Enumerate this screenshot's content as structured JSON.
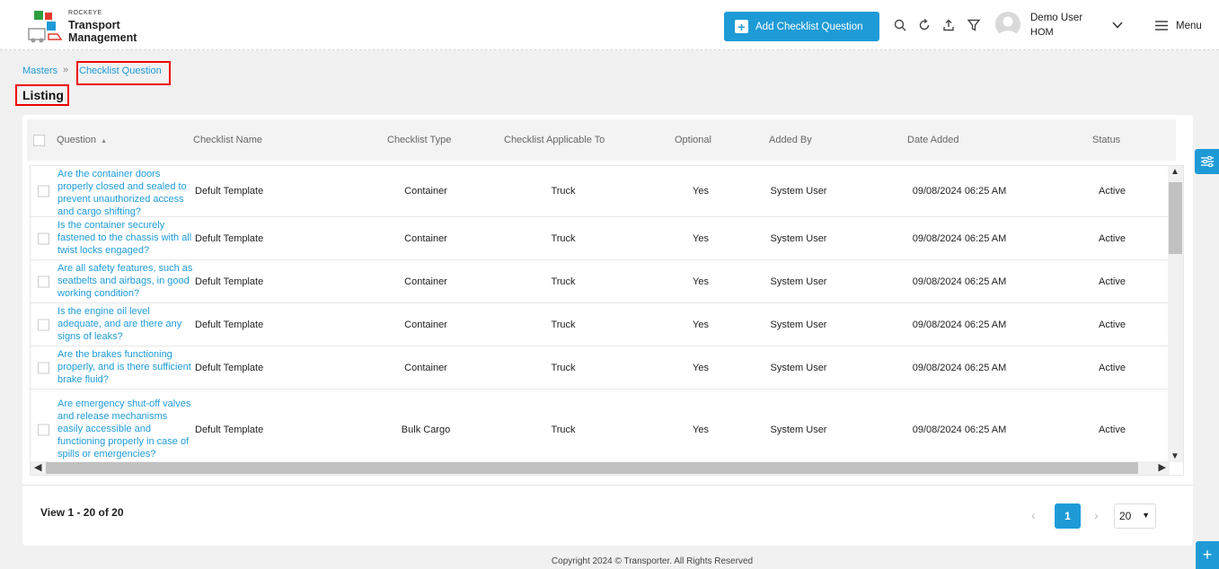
{
  "brand": {
    "small": "ROCKEYE",
    "line1": "Transport",
    "line2": "Management"
  },
  "header": {
    "add_button_label": "Add Checklist Question",
    "icons": [
      "search-icon",
      "refresh-icon",
      "upload-icon",
      "filter-icon"
    ],
    "user_name": "Demo User",
    "user_role": "HOM",
    "menu_label": "Menu"
  },
  "breadcrumb": {
    "parent": "Masters",
    "separator": "»",
    "current": "Checklist Question"
  },
  "page_title": "Listing",
  "table": {
    "columns": {
      "question": "Question",
      "checklist_name": "Checklist Name",
      "checklist_type": "Checklist Type",
      "applicable_to": "Checklist Applicable To",
      "optional": "Optional",
      "added_by": "Added By",
      "date_added": "Date Added",
      "status": "Status"
    },
    "sort_indicator": "▲",
    "rows": [
      {
        "question": "Are the container doors properly closed and sealed to prevent unauthorized access and cargo shifting?",
        "checklist_name": "Defult Template",
        "checklist_type": "Container",
        "applicable_to": "Truck",
        "optional": "Yes",
        "added_by": "System User",
        "date_added": "09/08/2024 06:25 AM",
        "status": "Active"
      },
      {
        "question": "Is the container securely fastened to the chassis with all twist locks engaged?",
        "checklist_name": "Defult Template",
        "checklist_type": "Container",
        "applicable_to": "Truck",
        "optional": "Yes",
        "added_by": "System User",
        "date_added": "09/08/2024 06:25 AM",
        "status": "Active"
      },
      {
        "question": "Are all safety features, such as seatbelts and airbags, in good working condition?",
        "checklist_name": "Defult Template",
        "checklist_type": "Container",
        "applicable_to": "Truck",
        "optional": "Yes",
        "added_by": "System User",
        "date_added": "09/08/2024 06:25 AM",
        "status": "Active"
      },
      {
        "question": "Is the engine oil level adequate, and are there any signs of leaks?",
        "checklist_name": "Defult Template",
        "checklist_type": "Container",
        "applicable_to": "Truck",
        "optional": "Yes",
        "added_by": "System User",
        "date_added": "09/08/2024 06:25 AM",
        "status": "Active"
      },
      {
        "question": "Are the brakes functioning properly, and is there sufficient brake fluid?",
        "checklist_name": "Defult Template",
        "checklist_type": "Container",
        "applicable_to": "Truck",
        "optional": "Yes",
        "added_by": "System User",
        "date_added": "09/08/2024 06:25 AM",
        "status": "Active"
      },
      {
        "question": "Are emergency shut-off valves and release mechanisms easily accessible and functioning properly in case of spills or emergencies?",
        "checklist_name": "Defult Template",
        "checklist_type": "Bulk Cargo",
        "applicable_to": "Truck",
        "optional": "Yes",
        "added_by": "System User",
        "date_added": "09/08/2024 06:25 AM",
        "status": "Active"
      }
    ]
  },
  "pagination": {
    "view_text": "View 1 - 20 of 20",
    "current_page": "1",
    "page_size": "20"
  },
  "footer": "Copyright 2024 © Transporter. All Rights Reserved",
  "colors": {
    "accent": "#1e9bd7",
    "highlight_border": "#e00000"
  }
}
